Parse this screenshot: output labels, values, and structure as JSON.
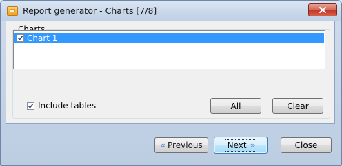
{
  "window": {
    "title": "Report generator - Charts [7/8]"
  },
  "group": {
    "label": "Charts"
  },
  "chart_list": {
    "items": [
      {
        "label": "Chart 1",
        "checked": true,
        "selected": true
      }
    ]
  },
  "include_tables": {
    "label": "Include tables",
    "checked": true
  },
  "buttons": {
    "all_label": "All",
    "clear_label": "Clear",
    "previous_label": "Previous",
    "next_label": "Next",
    "close_label": "Close"
  },
  "icons": {
    "app": "report-generator-icon",
    "close": "close-icon",
    "previous": "double-chevron-left-icon",
    "next": "double-chevron-right-icon",
    "checkbox": "checkmark-icon"
  },
  "colors": {
    "selection": "#3399ff",
    "close_button": "#c0392b",
    "accent_arrows": "#5b8ed0"
  }
}
